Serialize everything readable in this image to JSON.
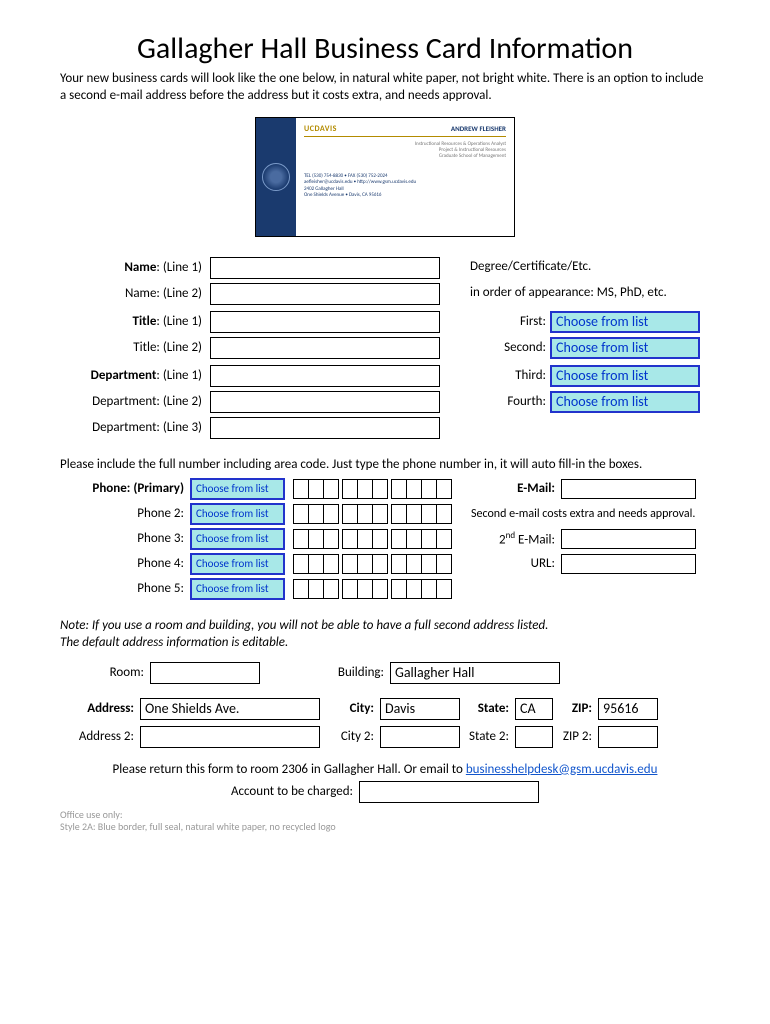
{
  "title": "Gallagher Hall Business Card Information",
  "intro": "Your new business cards will look like the one below, in natural white paper, not bright white. There is an option to include a second e-mail address before the address but it costs extra, and needs approval.",
  "card": {
    "brand": "UCDAVIS",
    "name": "ANDREW FLEISHER",
    "line1": "Instructional Resources & Operations Analyst",
    "line2": "Project & Instructional Resources",
    "line3": "Graduate School of Management",
    "tel": "TEL (530) 754-8830 • FAX (530) 752-2024",
    "email": "aefleisher@ucdavis.edu • http://www.gsm.ucdavis.edu",
    "addr1": "2402 Gallagher Hall",
    "addr2": "One Shields Avenue • Davis, CA 95616"
  },
  "labels": {
    "name1": "Name: (Line 1)",
    "name2": "Name: (Line 2)",
    "title1": "Title: (Line 1)",
    "title2": "Title: (Line 2)",
    "dept1": "Department: (Line 1)",
    "dept2": "Department: (Line 2)",
    "dept3": "Department: (Line 3)"
  },
  "degree_note_l1": "Degree/Certificate/Etc.",
  "degree_note_l2": "in order of appearance: MS, PhD, etc.",
  "deg_labels": {
    "first": "First:",
    "second": "Second:",
    "third": "Third:",
    "fourth": "Fourth:"
  },
  "choose_from_list": "Choose from list",
  "phone_instr": "Please include the full number including area code. Just type the phone number in, it will auto fill-in the boxes.",
  "phone_labels": {
    "p1": "Phone: (Primary)",
    "p2": "Phone 2:",
    "p3": "Phone 3:",
    "p4": "Phone 4:",
    "p5": "Phone 5:"
  },
  "email_label": "E-Mail:",
  "second_email_note": "Second e-mail costs extra and needs approval.",
  "email2_label_pre": "2",
  "email2_label_sup": "nd",
  "email2_label_post": " E-Mail:",
  "url_label": "URL:",
  "note": "Note: If you use a room and building, you will not be able to have a full second address listed.\nThe default address information is editable.",
  "addr": {
    "room_label": "Room:",
    "building_label": "Building:",
    "building_value": "Gallagher Hall",
    "address_label": "Address:",
    "address_value": "One Shields Ave.",
    "city_label": "City:",
    "city_value": "Davis",
    "state_label": "State:",
    "state_value": "CA",
    "zip_label": "ZIP:",
    "zip_value": "95616",
    "address2_label": "Address 2:",
    "city2_label": "City 2:",
    "state2_label": "State 2:",
    "zip2_label": "ZIP 2:"
  },
  "return_pre": "Please return this form to room 2306 in Gallagher Hall. Or email to ",
  "return_link": "businesshelpdesk@gsm.ucdavis.edu",
  "account_label": "Account to be charged:",
  "office_use_l1": "Office use only:",
  "office_use_l2": "Style 2A: Blue border, full seal, natural white paper, no recycled logo"
}
